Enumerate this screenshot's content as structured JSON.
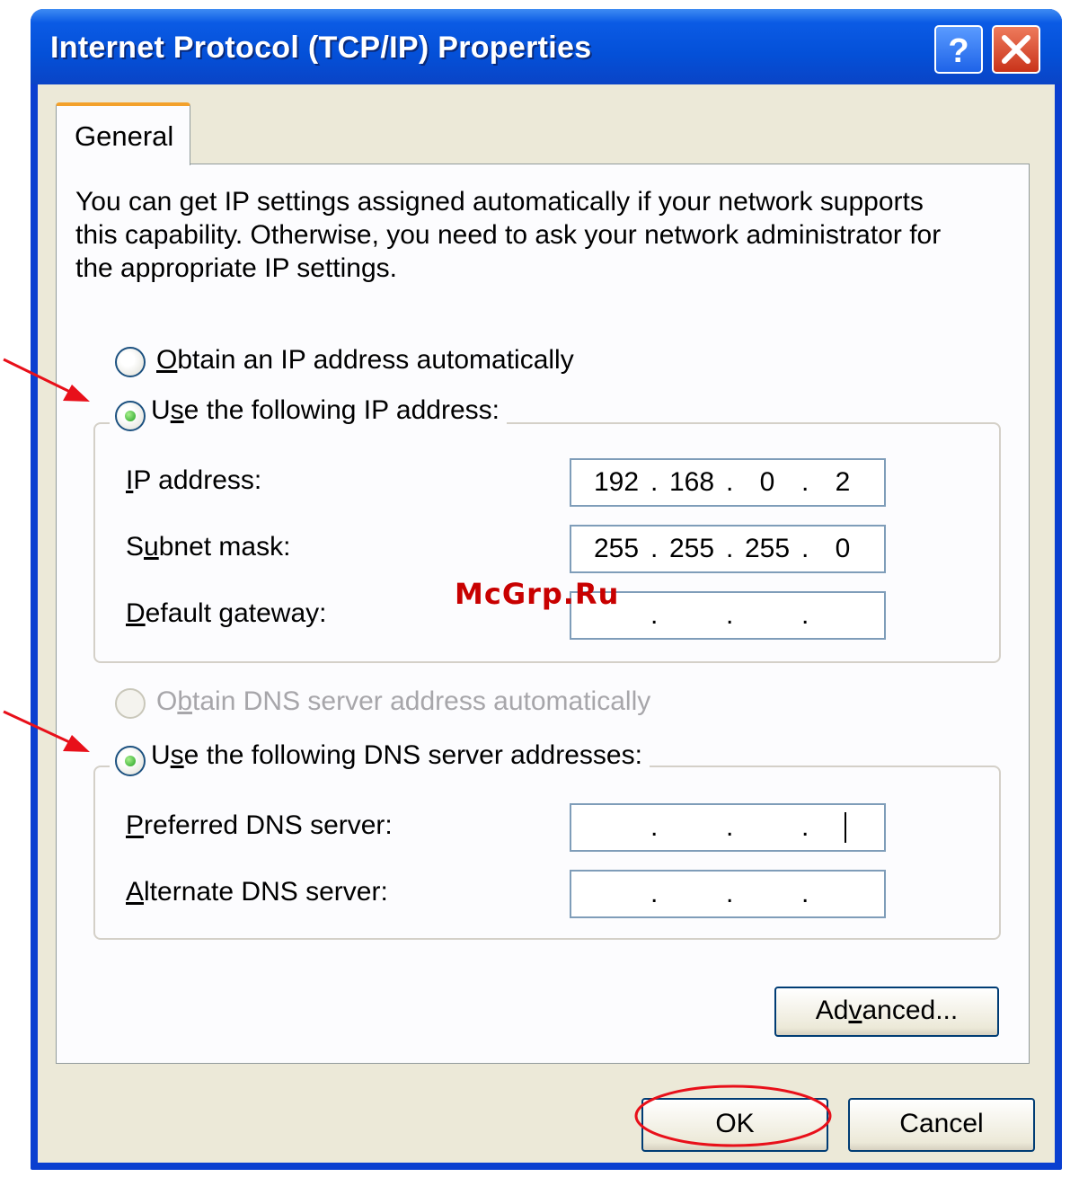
{
  "window": {
    "title": "Internet Protocol (TCP/IP) Properties",
    "help_label": "?",
    "close_label": "X"
  },
  "tabs": [
    {
      "label": "General",
      "selected": true
    }
  ],
  "description": [
    "You can get IP settings assigned automatically if your network supports",
    "this capability. Otherwise, you need to ask your network administrator for",
    "the appropriate IP settings."
  ],
  "ip_section": {
    "auto_option": {
      "pre": "",
      "u": "O",
      "post": "btain an IP address automatically",
      "selected": false
    },
    "manual_option": {
      "pre": "U",
      "u": "s",
      "post": "e the following IP address:",
      "selected": true
    },
    "fields": [
      {
        "pre": "",
        "u": "I",
        "post": "P address:",
        "octets": [
          "192",
          "168",
          "0",
          "2"
        ]
      },
      {
        "pre": "S",
        "u": "u",
        "post": "bnet mask:",
        "octets": [
          "255",
          "255",
          "255",
          "0"
        ]
      },
      {
        "pre": "",
        "u": "D",
        "post": "efault gateway:",
        "octets": [
          "",
          "",
          "",
          ""
        ]
      }
    ]
  },
  "dns_section": {
    "auto_option": {
      "pre": "O",
      "u": "b",
      "post": "tain DNS server address automatically",
      "selected": false,
      "enabled": false
    },
    "manual_option": {
      "pre": "U",
      "u": "s",
      "post": "e the following DNS server addresses:",
      "selected": true
    },
    "fields": [
      {
        "pre": "",
        "u": "P",
        "post": "referred DNS server:",
        "octets": [
          "",
          "",
          "",
          ""
        ]
      },
      {
        "pre": "",
        "u": "A",
        "post": "lternate DNS server:",
        "octets": [
          "",
          "",
          "",
          ""
        ]
      }
    ]
  },
  "octet_separator": ".",
  "buttons": {
    "advanced": {
      "pre": "Ad",
      "u": "v",
      "post": "anced..."
    },
    "ok": "OK",
    "cancel": "Cancel"
  },
  "watermark": "McGrp.Ru",
  "annotations": {
    "arrow_color": "#e8101a",
    "ellipse_color": "#e8101a"
  },
  "colors": {
    "titlebar": "#0450d8",
    "dialog_bg": "#ece9d8",
    "tab_accent": "#f3a12b",
    "radio_selected": "#21a121"
  }
}
